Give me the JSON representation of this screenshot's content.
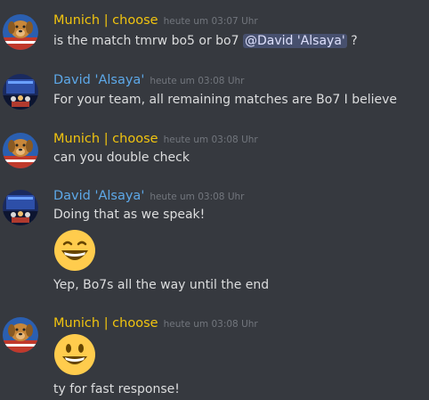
{
  "messages": [
    {
      "author": "Munich | choose",
      "timestamp": "heute um 03:07 Uhr",
      "text_before_mention": "is the match tmrw bo5 or bo7 ",
      "mention": "@David 'Alsaya'",
      "text_after_mention": " ?"
    },
    {
      "author": "David 'Alsaya'",
      "timestamp": "heute um 03:08 Uhr",
      "text": "For your team, all remaining matches are Bo7 I believe"
    },
    {
      "author": "Munich | choose",
      "timestamp": "heute um 03:08 Uhr",
      "text": "can you double check"
    },
    {
      "author": "David 'Alsaya'",
      "timestamp": "heute um 03:08 Uhr",
      "text": "Doing that as we speak!",
      "emoji": "grinning-squinting-face",
      "text2": "Yep, Bo7s all the way until the end"
    },
    {
      "author": "Munich | choose",
      "timestamp": "heute um 03:08 Uhr",
      "emoji": "grinning-face",
      "text": "ty for fast response!"
    }
  ],
  "colors": {
    "background": "#36393f",
    "author_munich": "#f1c40f",
    "author_david": "#5da8e8",
    "text": "#dcddde",
    "timestamp": "#72767d",
    "mention_bg": "#414675",
    "emoji_yellow": "#ffcc4d"
  },
  "icons": {
    "munich_avatar": "dog-avatar",
    "david_avatar": "stage-avatar"
  }
}
